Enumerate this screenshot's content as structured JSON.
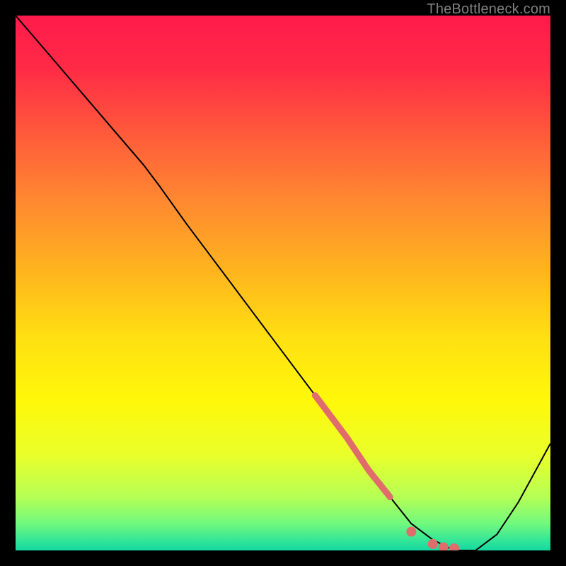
{
  "attribution": "TheBottleneck.com",
  "chart_data": {
    "type": "line",
    "title": "",
    "xlabel": "",
    "ylabel": "",
    "xlim": [
      0,
      100
    ],
    "ylim": [
      0,
      100
    ],
    "grid": false,
    "legend": false,
    "background": {
      "type": "vertical-gradient",
      "stops": [
        {
          "offset": 0.0,
          "color": "#ff1a4b"
        },
        {
          "offset": 0.1,
          "color": "#ff2b46"
        },
        {
          "offset": 0.22,
          "color": "#ff5a3b"
        },
        {
          "offset": 0.35,
          "color": "#ff8a30"
        },
        {
          "offset": 0.48,
          "color": "#ffb51e"
        },
        {
          "offset": 0.6,
          "color": "#ffdf12"
        },
        {
          "offset": 0.72,
          "color": "#fff80a"
        },
        {
          "offset": 0.82,
          "color": "#eaff2a"
        },
        {
          "offset": 0.9,
          "color": "#b6ff55"
        },
        {
          "offset": 0.95,
          "color": "#70f97e"
        },
        {
          "offset": 0.985,
          "color": "#2de39a"
        },
        {
          "offset": 1.0,
          "color": "#15d8a0"
        }
      ]
    },
    "series": [
      {
        "name": "bottleneck-curve",
        "type": "line",
        "color": "#000000",
        "stroke_width": 2,
        "x": [
          0,
          6,
          12,
          18,
          24,
          27,
          32,
          38,
          44,
          50,
          56,
          62,
          66,
          70,
          74,
          78,
          82,
          86,
          90,
          94,
          100
        ],
        "y": [
          100,
          93,
          86,
          79,
          72,
          68,
          61,
          53,
          45,
          37,
          29,
          21,
          15,
          10,
          5,
          2,
          0,
          0,
          3,
          9,
          20
        ]
      },
      {
        "name": "highlight-segment",
        "type": "line",
        "color": "#e06c6c",
        "stroke_width": 9,
        "linecap": "round",
        "x": [
          56,
          62,
          66,
          70
        ],
        "y": [
          29,
          21,
          15,
          10
        ]
      },
      {
        "name": "highlight-dots",
        "type": "scatter",
        "color": "#e06c6c",
        "size": 7,
        "x": [
          74,
          78,
          80,
          82
        ],
        "y": [
          3.5,
          1.2,
          0.6,
          0.4
        ]
      }
    ]
  }
}
